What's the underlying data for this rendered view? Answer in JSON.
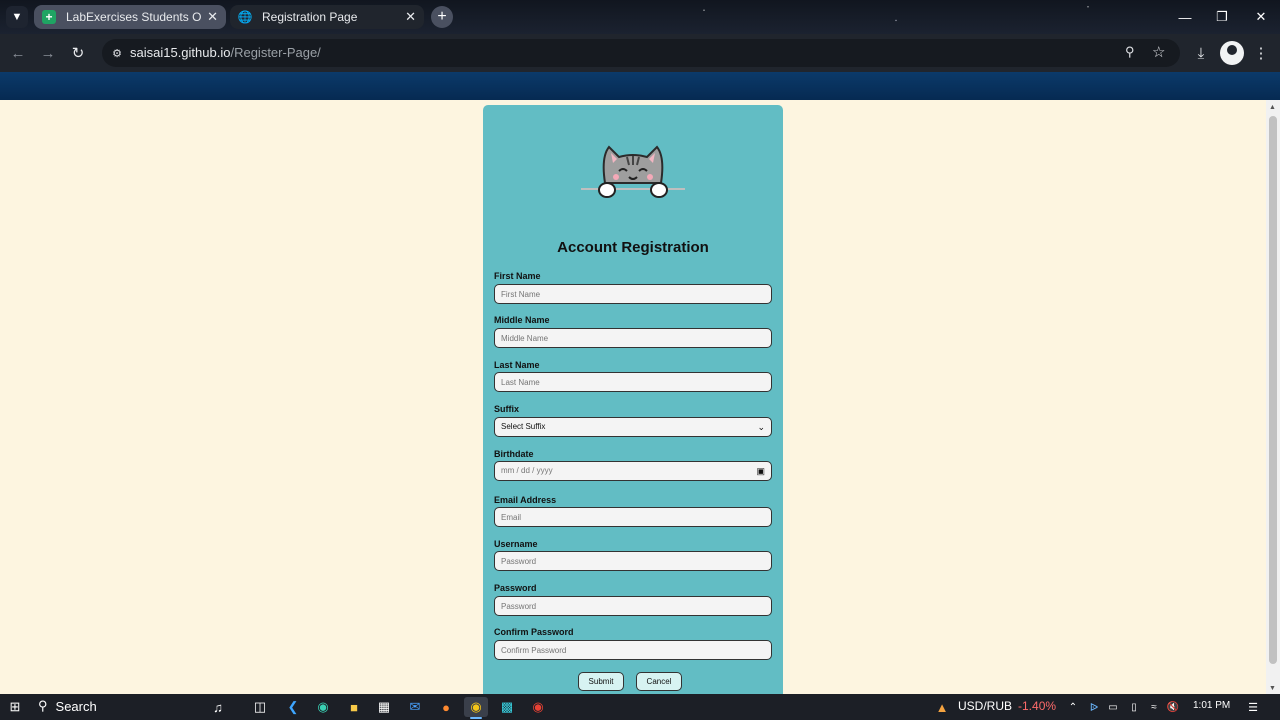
{
  "browser": {
    "tabs": [
      {
        "label": "LabExercises Students Outputs",
        "favicon": "green-plus-icon"
      },
      {
        "label": "Registration Page",
        "favicon": "globe-icon"
      }
    ],
    "url_host": "saisai15.github.io",
    "url_path": "/Register-Page/"
  },
  "form": {
    "title": "Account Registration",
    "fields": [
      {
        "label": "First Name",
        "placeholder": "First Name"
      },
      {
        "label": "Middle Name",
        "placeholder": "Middle Name"
      },
      {
        "label": "Last Name",
        "placeholder": "Last Name"
      },
      {
        "label": "Suffix",
        "value": "Select Suffix"
      },
      {
        "label": "Birthdate",
        "placeholder": "mm / dd / yyyy"
      },
      {
        "label": "Email Address",
        "placeholder": "Email"
      },
      {
        "label": "Username",
        "placeholder": "Password"
      },
      {
        "label": "Password",
        "placeholder": "Password"
      },
      {
        "label": "Confirm Password",
        "placeholder": "Confirm Password"
      }
    ],
    "submit_label": "Submit",
    "cancel_label": "Cancel",
    "card_color": "#62bdc4",
    "page_bg": "#fdf5e0"
  },
  "taskbar": {
    "search_label": "Search",
    "ticker_pair": "USD/RUB",
    "ticker_change": "-1.40%",
    "time": "1:01 PM"
  }
}
